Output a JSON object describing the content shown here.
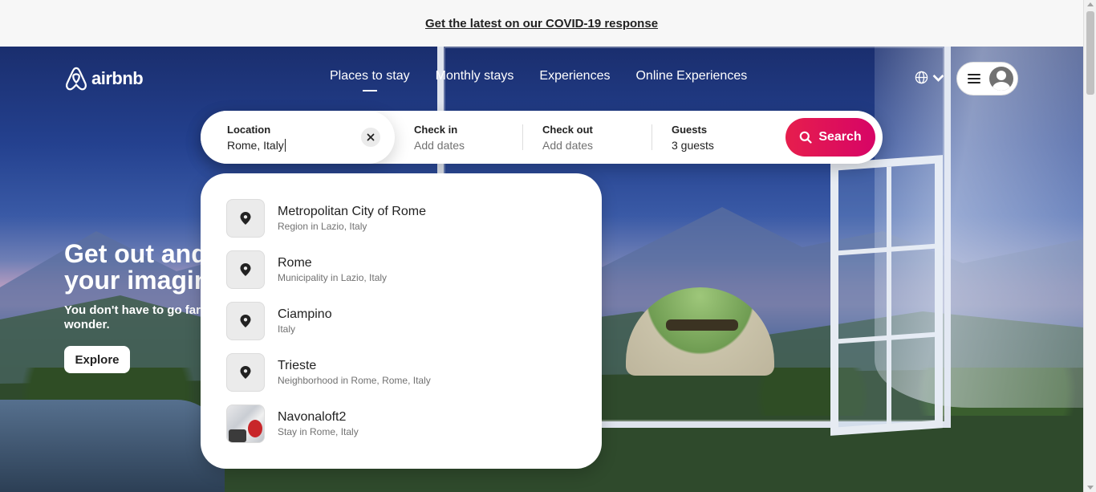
{
  "banner": {
    "link_text": "Get the latest on our COVID-19 response"
  },
  "brand": {
    "name": "airbnb"
  },
  "nav": {
    "items": [
      {
        "label": "Places to stay",
        "active": true
      },
      {
        "label": "Monthly stays",
        "active": false
      },
      {
        "label": "Experiences",
        "active": false
      },
      {
        "label": "Online Experiences",
        "active": false
      }
    ]
  },
  "search": {
    "location_label": "Location",
    "location_value": "Rome, Italy",
    "checkin_label": "Check in",
    "checkin_placeholder": "Add dates",
    "checkout_label": "Check out",
    "checkout_placeholder": "Add dates",
    "guests_label": "Guests",
    "guests_value": "3 guests",
    "button_label": "Search"
  },
  "hero": {
    "heading_line1": "Get out and",
    "heading_line2": "your imagination",
    "subtext": "You don't have to go far to find a world of wonder.",
    "explore_label": "Explore"
  },
  "suggestions": [
    {
      "title": "Metropolitan City of Rome",
      "subtitle": "Region in Lazio, Italy",
      "icon": "location-pin-icon"
    },
    {
      "title": "Rome",
      "subtitle": "Municipality in Lazio, Italy",
      "icon": "location-pin-icon"
    },
    {
      "title": "Ciampino",
      "subtitle": "Italy",
      "icon": "location-pin-icon"
    },
    {
      "title": "Trieste",
      "subtitle": "Neighborhood in Rome, Rome, Italy",
      "icon": "location-pin-icon"
    },
    {
      "title": "Navonaloft2",
      "subtitle": "Stay in Rome, Italy",
      "icon": "listing-photo"
    }
  ],
  "colors": {
    "brand": "#FF385C",
    "search_button": "#E61E4D",
    "text": "#222222",
    "muted": "#717171"
  }
}
